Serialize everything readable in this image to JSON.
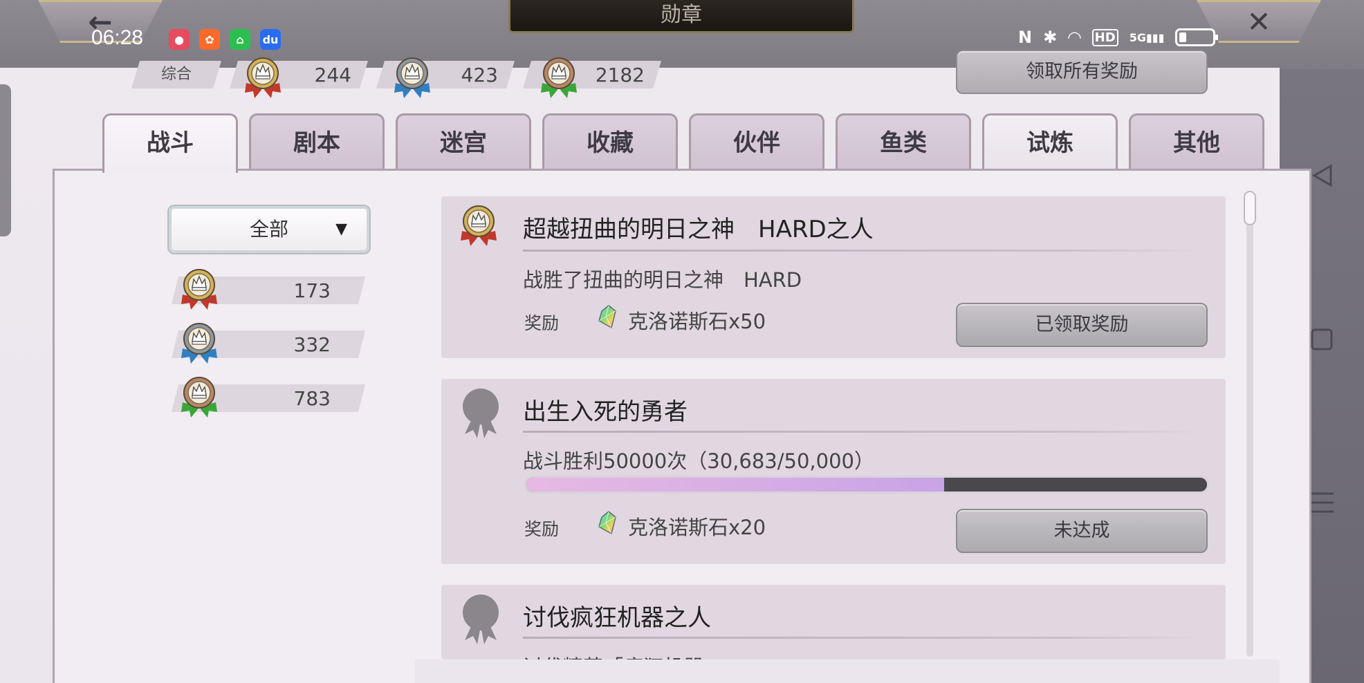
{
  "window": {
    "title": "勋章"
  },
  "status_bar": {
    "time": "06:28",
    "apps": [
      {
        "icon": "screen-record-icon",
        "color": "#e84a5f",
        "glyph": "●"
      },
      {
        "icon": "kuaishou-icon",
        "color": "#ff6a2a",
        "glyph": "✿"
      },
      {
        "icon": "app-store-icon",
        "color": "#2bbf4f",
        "glyph": "⌂"
      },
      {
        "icon": "baidu-icon",
        "color": "#2a6cf0",
        "glyph": "du"
      }
    ],
    "indicators": [
      "N",
      "✱",
      "◠",
      "HD",
      "5G",
      "▮▮▮"
    ]
  },
  "summary": {
    "label": "综合",
    "items": [
      {
        "medal": "gold",
        "count": "244"
      },
      {
        "medal": "silver",
        "count": "423"
      },
      {
        "medal": "bronze",
        "count": "2182"
      }
    ]
  },
  "claim_all_label": "领取所有奖励",
  "tabs": [
    "战斗",
    "剧本",
    "迷宫",
    "收藏",
    "伙伴",
    "鱼类",
    "试炼",
    "其他"
  ],
  "active_tab": "战斗",
  "filter": {
    "selected": "全部"
  },
  "medal_counts": [
    {
      "medal": "gold",
      "count": "173"
    },
    {
      "medal": "silver",
      "count": "332"
    },
    {
      "medal": "bronze",
      "count": "783"
    }
  ],
  "achievements": [
    {
      "title": "超越扭曲的明日之神　HARD之人",
      "description": "战胜了扭曲的明日之神　HARD",
      "reward_label": "奖励",
      "reward": "克洛诺斯石x50",
      "button": "已领取奖励",
      "medal": "gold"
    },
    {
      "title": "出生入死的勇者",
      "description": "战斗胜利50000次（30,683/50,000）",
      "progress": 0.61366,
      "reward_label": "奖励",
      "reward": "克洛诺斯石x20",
      "button": "未达成",
      "medal": "locked"
    },
    {
      "title": "讨伐疯狂机器之人",
      "description": "讨伐精英「疯狂机器",
      "medal": "locked"
    }
  ],
  "colors": {
    "panel": "#eee8ef",
    "card": "#e1d7e1",
    "gold": "#d4b25a",
    "silver": "#8c99a6",
    "bronze": "#b8876a",
    "ribbon_gold": "#c0392b",
    "ribbon_silver": "#2f7fc1",
    "ribbon_bronze": "#3aa63a"
  }
}
